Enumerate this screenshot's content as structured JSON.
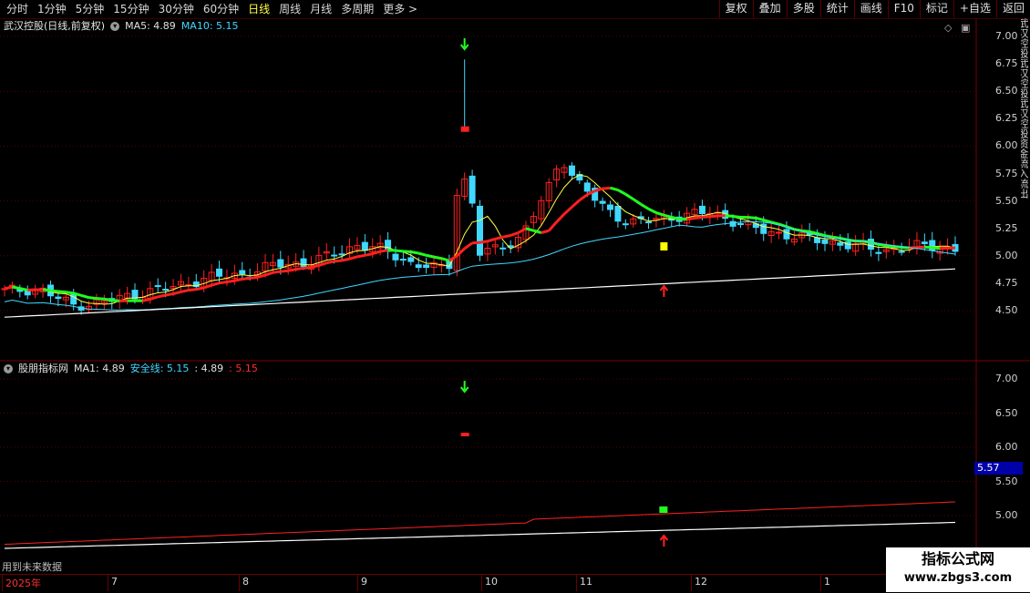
{
  "toolbar": {
    "periods": [
      "分时",
      "1分钟",
      "5分钟",
      "15分钟",
      "30分钟",
      "60分钟",
      "日线",
      "周线",
      "月线",
      "多周期",
      "更多 >"
    ],
    "active_period": "日线",
    "right_buttons": [
      "复权",
      "叠加",
      "多股",
      "统计",
      "画线",
      "F10",
      "标记",
      "+自选",
      "返回"
    ]
  },
  "main_panel": {
    "stock_title": "武汉控股(日线,前复权)",
    "ma5_label": "MA5: 4.89",
    "ma10_label": "MA10: 5.15",
    "y_ticks": [
      "7.00",
      "6.75",
      "6.50",
      "6.25",
      "6.00",
      "5.75",
      "5.50",
      "5.25",
      "5.00",
      "4.75",
      "4.50"
    ],
    "right_strip_text": "武汉控股武汉控股武汉控股资金流入流出"
  },
  "indicator_panel": {
    "name": "股朋指标网",
    "ma1_label": "MA1: 4.89",
    "safe_label": "安全线: 5.15",
    "extra1": ": 4.89",
    "extra2": ": 5.15",
    "y_ticks": [
      "7.00",
      "6.50",
      "6.00",
      "5.50",
      "5.00"
    ],
    "current_value": "5.57"
  },
  "x_axis": {
    "labels": [
      "2025年",
      "7",
      "8",
      "9",
      "10",
      "11",
      "12",
      "1"
    ]
  },
  "future_note": "用到未来数据",
  "watermark": {
    "line1": "指标公式网",
    "line2": "www.zbgs3.com"
  },
  "colors": {
    "up": "#ff2020",
    "down": "#40d8ff",
    "ma5": "#ffff40",
    "ma10": "#40d8ff",
    "trend_green": "#20ff20",
    "trend_red": "#ff2020",
    "white_line": "#ffffff",
    "grid": "#5a0000"
  },
  "chart_data": {
    "type": "candlestick",
    "ylim": [
      4.3,
      7.05
    ],
    "sell_arrow_index": 60,
    "buy_arrow_index": 86,
    "spike_high": 6.79,
    "spike_close": 6.18
  }
}
